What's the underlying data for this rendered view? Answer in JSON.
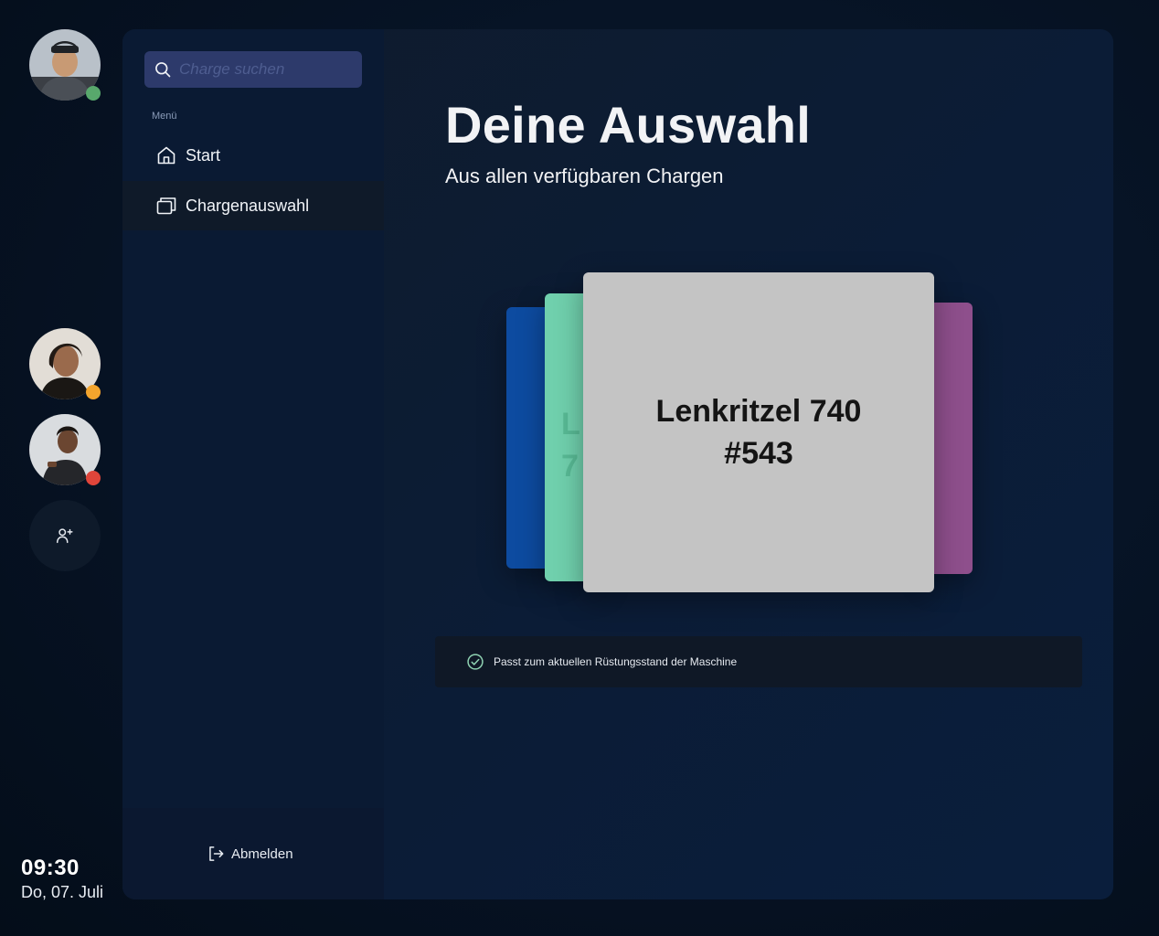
{
  "users": [
    {
      "name": "user-1",
      "status": "online",
      "status_color": "#58a86c"
    },
    {
      "name": "user-2",
      "status": "away",
      "status_color": "#f4a52d"
    },
    {
      "name": "user-3",
      "status": "busy",
      "status_color": "#e0453a"
    }
  ],
  "clock": {
    "time": "09:30",
    "date": "Do, 07. Juli"
  },
  "search": {
    "placeholder": "Charge suchen"
  },
  "sidebar": {
    "menu_label": "Menü",
    "items": [
      {
        "label": "Start",
        "icon": "home-icon"
      },
      {
        "label": "Chargenauswahl",
        "icon": "cards-icon",
        "active": true
      }
    ],
    "logout_label": "Abmelden"
  },
  "main": {
    "title": "Deine Auswahl",
    "subtitle": "Aus allen verfügbaren Chargen",
    "selected_card": {
      "name": "Lenkritzel 740",
      "number": "#543"
    },
    "card_colors": [
      "#0d4ba0",
      "#70d0ad",
      "#c4c4c4",
      "#8e4f8c"
    ],
    "info_text": "Passt zum aktuellen Rüstungsstand der Maschine"
  }
}
